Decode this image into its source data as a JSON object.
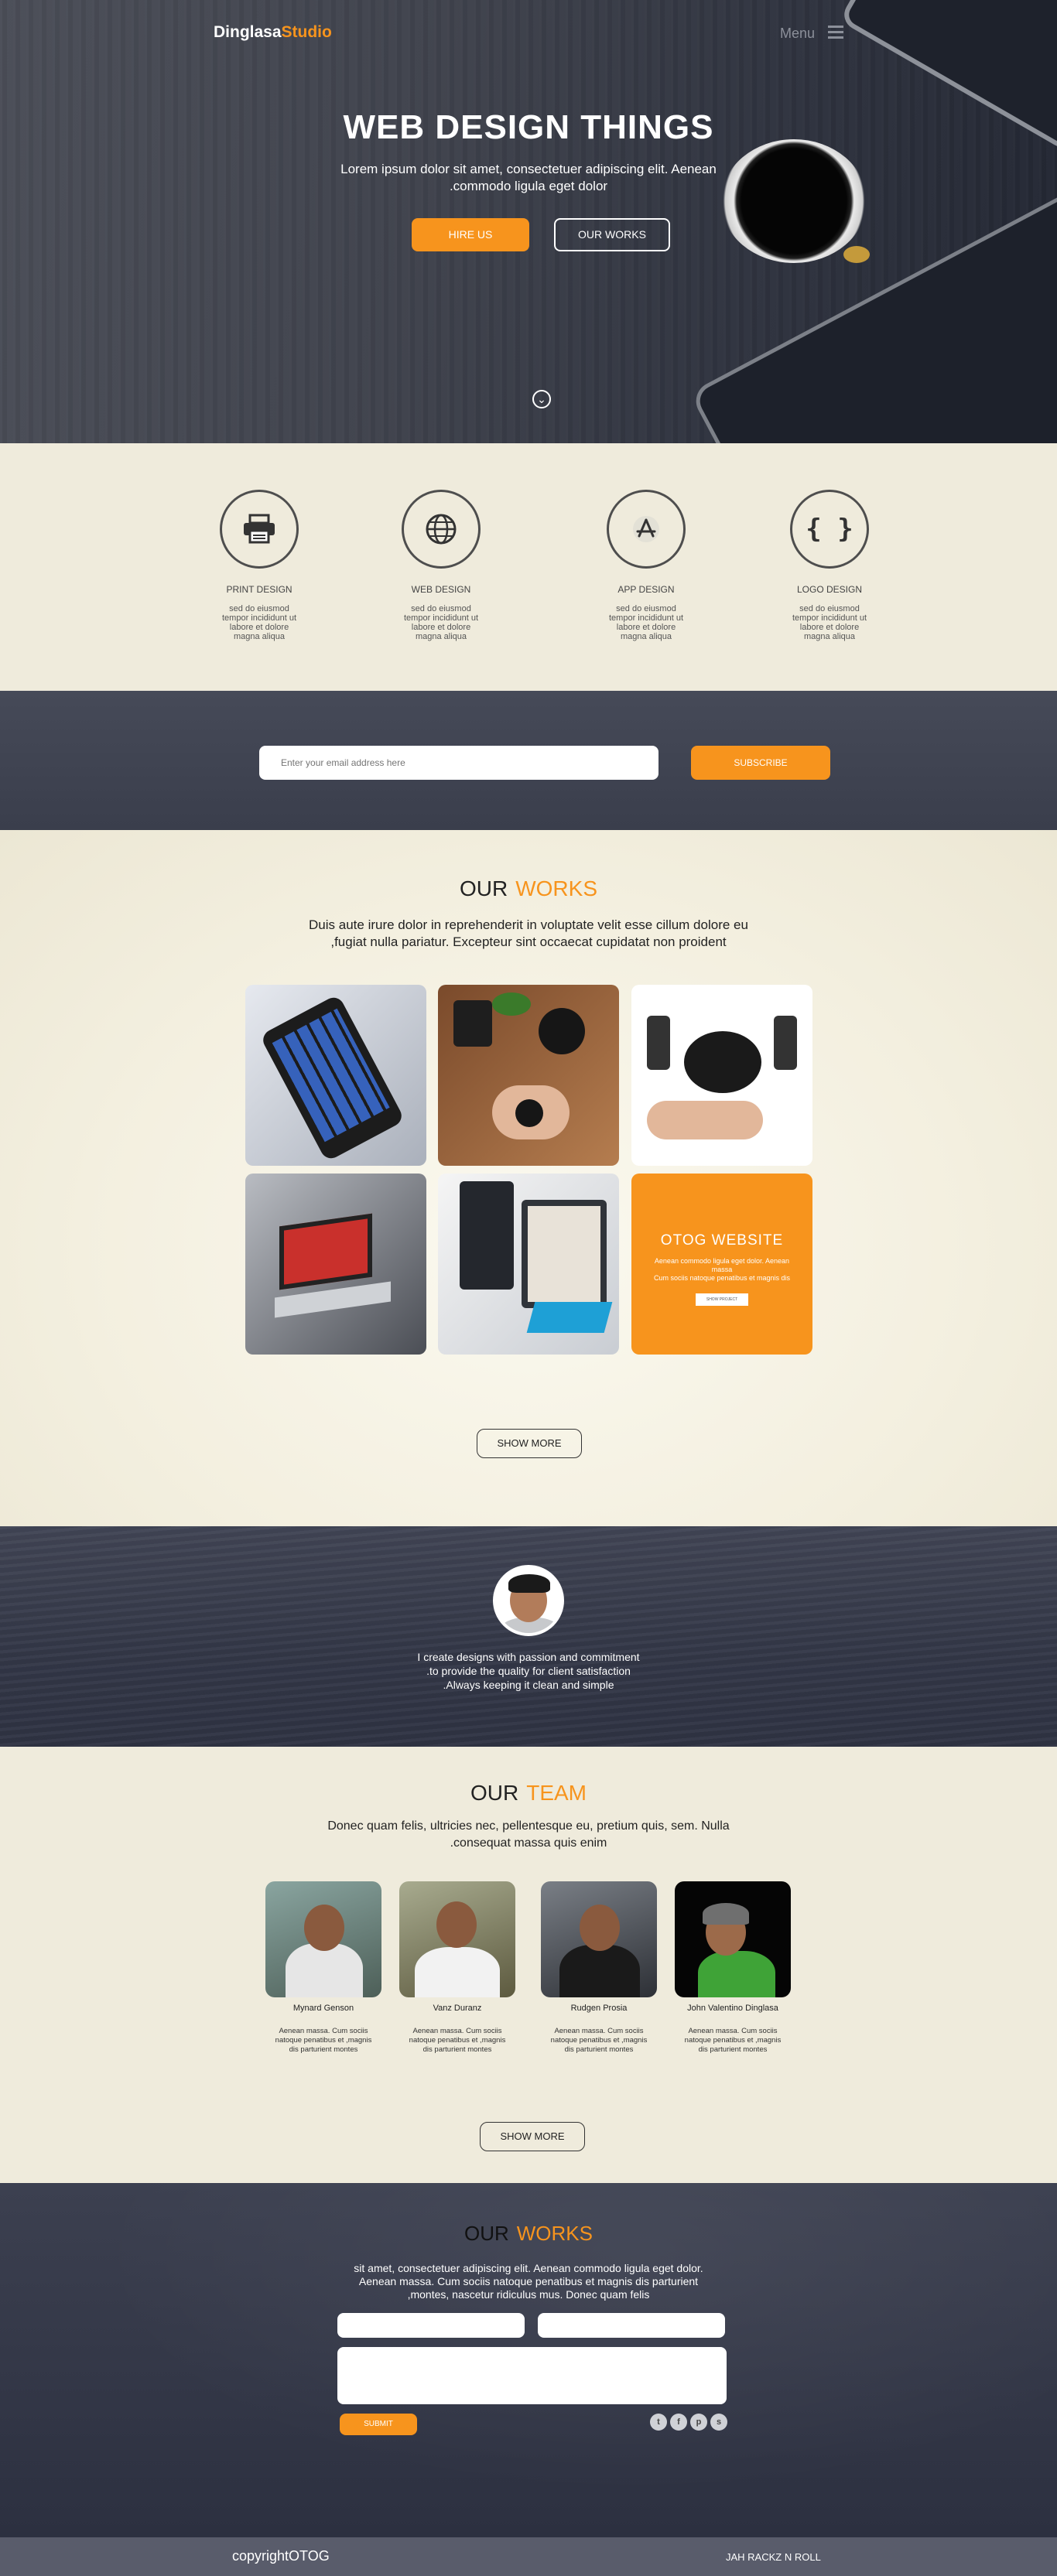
{
  "header": {
    "brand_main": "Dinglasa",
    "brand_accent": "Studio",
    "menu_label": "Menu"
  },
  "hero": {
    "title": "WEB DESIGN THINGS",
    "subtitle_line1": "Lorem ipsum dolor sit amet, consectetuer adipiscing elit. Aenean",
    "subtitle_line2": ".commodo ligula eget dolor",
    "hire_label": "HIRE US",
    "works_label": "OUR WORKS"
  },
  "services": [
    {
      "title": "PRINT DESIGN",
      "text": "sed do eiusmod tempor incididunt ut labore et dolore magna aliqua",
      "icon": "printer-icon"
    },
    {
      "title": "WEB DESIGN",
      "text": "sed do eiusmod tempor incididunt ut labore et dolore magna aliqua",
      "icon": "globe-icon"
    },
    {
      "title": "APP DESIGN",
      "text": "sed do eiusmod tempor incididunt ut labore et dolore magna aliqua",
      "icon": "app-store-icon"
    },
    {
      "title": "LOGO DESIGN",
      "text": "sed do eiusmod tempor incididunt ut labore et dolore magna aliqua",
      "icon": "curly-braces-icon"
    }
  ],
  "subscribe": {
    "placeholder": "Enter your email address here",
    "button_label": "SUBSCRIBE"
  },
  "works": {
    "title_main": "OUR",
    "title_accent": "WORKS",
    "desc_line1": "Duis aute irure dolor in reprehenderit in voluptate velit esse cillum dolore eu",
    "desc_line2": ",fugiat nulla pariatur. Excepteur sint occaecat cupidatat non proident",
    "featured_title": "OTOG WEBSITE",
    "featured_text_line1": "Aenean commodo ligula eget dolor. Aenean massa",
    "featured_text_line2": "Cum sociis natoque penatibus et magnis dis",
    "featured_button": "SHOW PROJECT",
    "show_more": "SHOW MORE"
  },
  "testimonial": {
    "line1": "I create designs with passion and commitment",
    "line2": ".to provide the quality for client satisfaction",
    "line3": ".Always keeping it clean and simple"
  },
  "team": {
    "title_main": "OUR",
    "title_accent": "TEAM",
    "desc_line1": "Donec quam felis, ultricies nec, pellentesque eu, pretium quis, sem. Nulla",
    "desc_line2": ".consequat massa quis enim",
    "members": [
      {
        "name": "Mynard  Genson",
        "bio": "Aenean massa. Cum sociis natoque penatibus et ,magnis dis parturient montes"
      },
      {
        "name": "Vanz Duranz",
        "bio": "Aenean massa. Cum sociis natoque penatibus et ,magnis dis parturient montes"
      },
      {
        "name": "Rudgen Prosia",
        "bio": "Aenean massa. Cum sociis natoque penatibus et ,magnis dis parturient montes"
      },
      {
        "name": "John Valentino Dinglasa",
        "bio": "Aenean massa. Cum sociis natoque penatibus et ,magnis dis parturient montes"
      }
    ],
    "show_more": "SHOW MORE"
  },
  "contact": {
    "title_main": "OUR",
    "title_accent": "WORKS",
    "desc_line1": "sit amet, consectetuer adipiscing elit. Aenean commodo ligula eget dolor.",
    "desc_line2": "Aenean massa. Cum sociis natoque penatibus et magnis dis parturient",
    "desc_line3": ",montes, nascetur ridiculus mus. Donec quam felis",
    "submit_label": "SUBMIT",
    "social": [
      "twitter-icon",
      "facebook-icon",
      "pinterest-icon",
      "skype-icon"
    ]
  },
  "footer": {
    "copyright": "copyrightOTOG",
    "tagline": "JAH RACKZ N ROLL"
  },
  "colors": {
    "accent": "#f7941d",
    "cream": "#efebdc",
    "dark": "#3a3e4c"
  }
}
